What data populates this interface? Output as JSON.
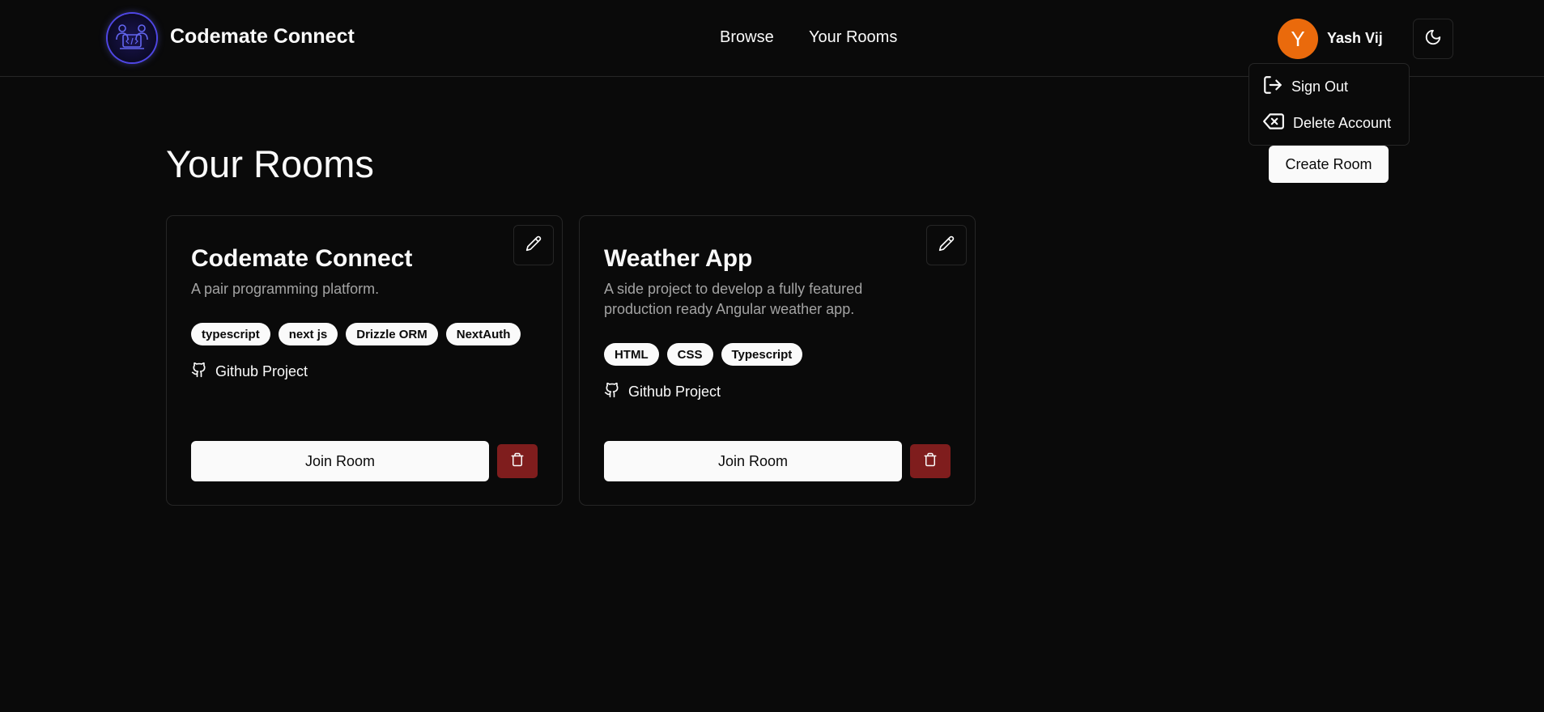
{
  "header": {
    "brand": "Codemate Connect",
    "nav": [
      {
        "label": "Browse"
      },
      {
        "label": "Your Rooms"
      }
    ],
    "user": {
      "initial": "Y",
      "name": "Yash Vij",
      "avatar_color": "#ea6a0c"
    },
    "theme_toggle_icon": "moon-icon"
  },
  "user_menu": {
    "items": [
      {
        "label": "Sign Out",
        "icon": "sign-out-icon"
      },
      {
        "label": "Delete Account",
        "icon": "delete-account-icon"
      }
    ]
  },
  "page": {
    "title": "Your Rooms",
    "create_label": "Create Room"
  },
  "rooms": [
    {
      "title": "Codemate Connect",
      "description": "A pair programming platform.",
      "tags": [
        "typescript",
        "next js",
        "Drizzle ORM",
        "NextAuth"
      ],
      "github_label": "Github Project",
      "join_label": "Join Room"
    },
    {
      "title": "Weather App",
      "description": "A side project to develop a fully featured production ready Angular weather app.",
      "tags": [
        "HTML",
        "CSS",
        "Typescript"
      ],
      "github_label": "Github Project",
      "join_label": "Join Room"
    }
  ],
  "colors": {
    "background": "#0a0a0a",
    "foreground": "#fafafa",
    "muted_text": "#a3a3a3",
    "border": "#262626",
    "destructive": "#7f1d1d",
    "logo_accent": "#4f46e5"
  }
}
